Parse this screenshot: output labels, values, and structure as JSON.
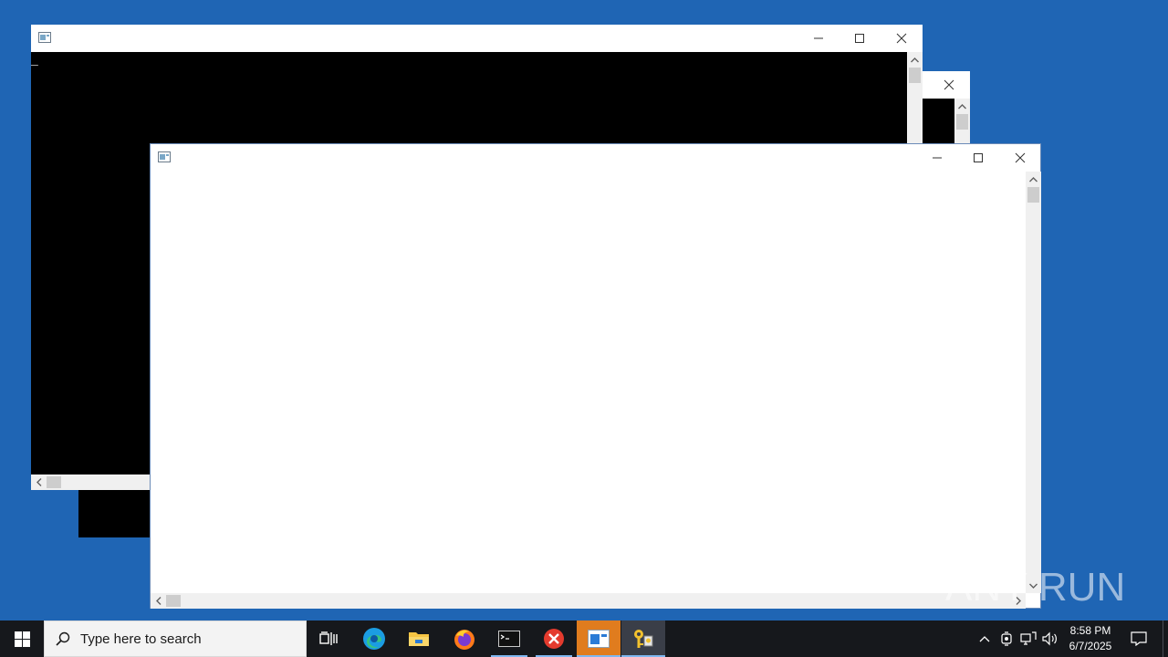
{
  "desktop": {
    "background_color": "#1f65b4"
  },
  "windows": {
    "back_console": {
      "title": "",
      "close_icon": "close-icon"
    },
    "main_console": {
      "title": "",
      "cursor": "_"
    },
    "front_window": {
      "title": ""
    }
  },
  "taskbar": {
    "search_placeholder": "Type here to search",
    "apps": [
      "start-icon",
      "task-view-icon",
      "edge-icon",
      "file-explorer-icon",
      "firefox-icon",
      "terminal-icon",
      "error-app-icon",
      "app-window-icon",
      "keys-app-icon"
    ],
    "tray": {
      "time": "8:58 PM",
      "date": "6/7/2025"
    }
  },
  "watermark": {
    "text": "ANY RUN"
  }
}
